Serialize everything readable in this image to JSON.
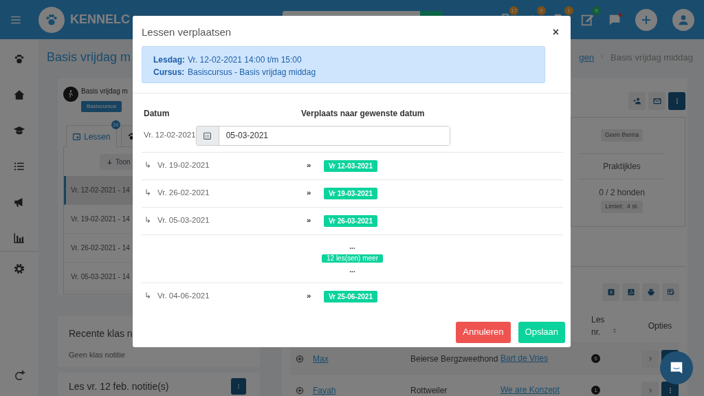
{
  "topbar": {
    "logo": "KENNELC",
    "notifications": [
      {
        "count": "17",
        "color": "#7a5018"
      },
      {
        "count": "5",
        "color": "#7a5018"
      },
      {
        "count": "1",
        "color": "#7a5018"
      },
      {
        "count": "0",
        "color": "#135c38"
      }
    ]
  },
  "page": {
    "title": "Basis vrijdag m",
    "breadcrumb": [
      "gen",
      "Basis vrijdag middag"
    ]
  },
  "course_card": {
    "name": "Basis vrijdag m",
    "badge": "Basiscursus",
    "tabs": [
      {
        "kind": "text",
        "label": "Lessen",
        "count": "24",
        "selected": true
      },
      {
        "kind": "icon",
        "selected": false
      }
    ],
    "show_button": "Toon",
    "lessons": [
      {
        "label": "Vr. 12-02-2021 - 14",
        "selected": true
      },
      {
        "label": "Vr. 19-02-2021 - 14",
        "selected": false
      },
      {
        "label": "Vr. 26-02-2021 - 14",
        "selected": false
      },
      {
        "label": "Vr. 05-03-2021 - 14",
        "selected": false
      }
    ]
  },
  "notes_card": {
    "title": "Recente klas n",
    "empty_text": "Geen klas notitie"
  },
  "lesson_notes_card": {
    "title": "Les vr. 12 feb. notitie(s)"
  },
  "info": {
    "theme": "Geen thema",
    "type": "Praktijkles",
    "occupancy": "0 / 2 honden",
    "limit": "Limiet:  4 st."
  },
  "table": {
    "columns": [
      {
        "label": "Les nr.",
        "sortable": true
      },
      {
        "label": "Opties",
        "sortable": false
      }
    ],
    "rows": [
      {
        "name": "Max",
        "breed": "Beierse Bergzweethond",
        "owner": "Bart de Vries",
        "lesson_nr": "5"
      },
      {
        "name": "Fayah",
        "breed": "Rottweiler",
        "owner": "We are Konzept",
        "lesson_nr": "1"
      }
    ]
  },
  "modal": {
    "title": "Lessen verplaatsen",
    "close": "×",
    "info": [
      {
        "label": "Lesdag:",
        "value": "Vr. 12-02-2021 14:00 t/m 15:00"
      },
      {
        "label": "Cursus:",
        "value": "Basiscursus - Basis vrijdag middag"
      }
    ],
    "columns": [
      "Datum",
      "Verplaats naar gewenste datum"
    ],
    "first": {
      "date": "Vr. 12-02-2021",
      "new_date": "05-03-2021"
    },
    "rows": [
      {
        "kind": "move",
        "arrow": "↳",
        "date": "Vr. 19-02-2021",
        "sep": "»",
        "new_date": "Vr 12-03-2021"
      },
      {
        "kind": "move",
        "arrow": "↳",
        "date": "Vr. 26-02-2021",
        "sep": "»",
        "new_date": "Vr 19-03-2021"
      },
      {
        "kind": "move",
        "arrow": "↳",
        "date": "Vr. 05-03-2021",
        "sep": "»",
        "new_date": "Vr 26-03-2021"
      },
      {
        "kind": "more",
        "dots_top": "...",
        "label": "12 les(sen) meer",
        "dots_bottom": "..."
      },
      {
        "kind": "move",
        "arrow": "↳",
        "date": "Vr. 04-06-2021",
        "sep": "»",
        "new_date": "Vr 25-06-2021"
      }
    ],
    "buttons": [
      {
        "kind": "cancel",
        "label": "Annuleren"
      },
      {
        "kind": "save",
        "label": "Opslaan"
      }
    ]
  }
}
